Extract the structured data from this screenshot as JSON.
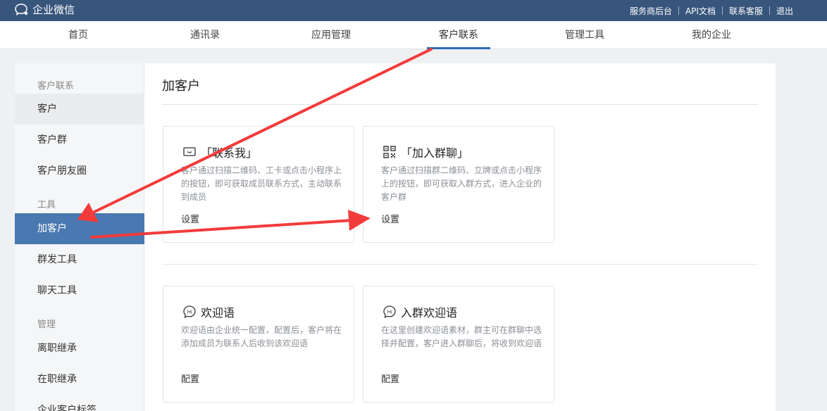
{
  "app": {
    "name": "企业微信"
  },
  "top_links": [
    "服务商后台",
    "API文档",
    "联系客服",
    "退出"
  ],
  "nav_tabs": [
    {
      "label": "首页"
    },
    {
      "label": "通讯录"
    },
    {
      "label": "应用管理"
    },
    {
      "label": "客户联系",
      "active": true
    },
    {
      "label": "管理工具"
    },
    {
      "label": "我的企业"
    }
  ],
  "sidebar": {
    "groups": {
      "contact": "客户联系",
      "tools": "工具",
      "manage": "管理"
    },
    "items": {
      "customer": "客户",
      "customer_group": "客户群",
      "moments": "客户朋友圈",
      "add_customer": "加客户",
      "mass_send": "群发工具",
      "chat_tool": "聊天工具",
      "resign_inherit": "离职继承",
      "active_inherit": "在职继承",
      "tags": "企业客户标签"
    }
  },
  "page": {
    "title": "加客户",
    "cards": [
      {
        "icon": "chat-bubble-icon",
        "title": "「联系我」",
        "desc": "客户通过扫描二维码、工卡或点击小程序上的按钮，即可获取成员联系方式，主动联系到成员",
        "link": "设置"
      },
      {
        "icon": "qr-code-icon",
        "title": "「加入群聊」",
        "desc": "客户通过扫描群二维码、立牌或点击小程序上的按钮，即可获取入群方式，进入企业的客户群",
        "link": "设置"
      },
      {
        "icon": "hi-bubble-icon",
        "title": "欢迎语",
        "desc": "欢迎语由企业统一配置，配置后，客户将在添加成员为联系人后收到该欢迎语",
        "link": "配置"
      },
      {
        "icon": "hi-bubble-icon",
        "title": "入群欢迎语",
        "desc": "在这里创建欢迎语素材，群主可在群聊中选择并配置，客户进入群聊后，将收到欢迎语",
        "link": "配置"
      }
    ]
  },
  "colors": {
    "topbar": "#38557c",
    "accent": "#2c6cb2",
    "sidebar_active": "#4a78b0",
    "annotation_arrow": "#f23b3b"
  }
}
